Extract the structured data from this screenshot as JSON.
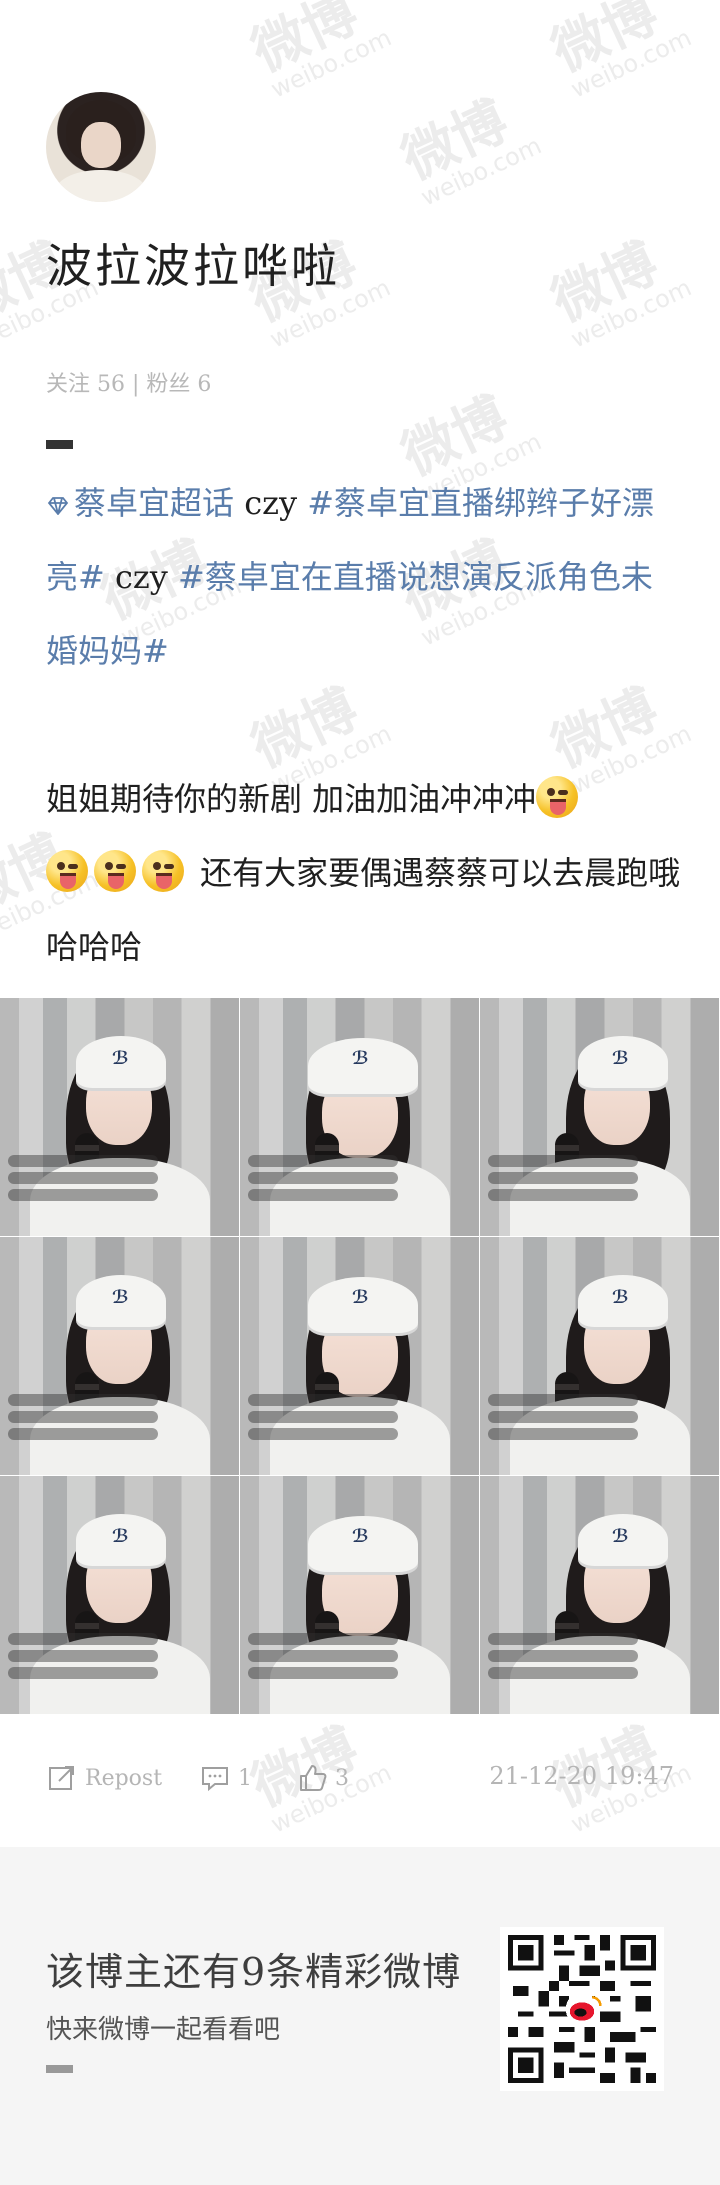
{
  "profile": {
    "name": "波拉波拉哗啦",
    "stats": "关注 56 | 粉丝 6"
  },
  "post": {
    "segments": [
      {
        "text": "蔡卓宜超话",
        "kind": "topic"
      },
      {
        "text": "  czy ",
        "kind": "plain"
      },
      {
        "text": "#蔡卓宜直播绑辫子好漂亮#",
        "kind": "topic"
      },
      {
        "text": " czy ",
        "kind": "plain"
      },
      {
        "text": "#蔡卓宜在直播说想演反派角色未婚妈妈#",
        "kind": "topic"
      }
    ],
    "body_line_1": "姐姐期待你的新剧 加油加油冲冲冲",
    "body_line_2": " 还有大家要偶遇蔡蔡可以去晨跑哦 哈哈哈"
  },
  "actions": {
    "repost_label": "Repost",
    "comment_count": "1",
    "like_count": "3",
    "timestamp": "21-12-20 19:47"
  },
  "footer": {
    "title": "该博主还有9条精彩微博",
    "subtitle": "快来微博一起看看吧"
  },
  "watermark": {
    "text": "微博",
    "subtext": "weibo.com"
  },
  "colors": {
    "topic": "#5a7dab",
    "text": "#1f1f1f",
    "muted": "#b5b5b5",
    "footer_bg": "#f5f5f5"
  },
  "icons": [
    "repost-icon",
    "comment-icon",
    "like-icon",
    "diamond-icon",
    "tongue-emoji",
    "qr-code"
  ]
}
